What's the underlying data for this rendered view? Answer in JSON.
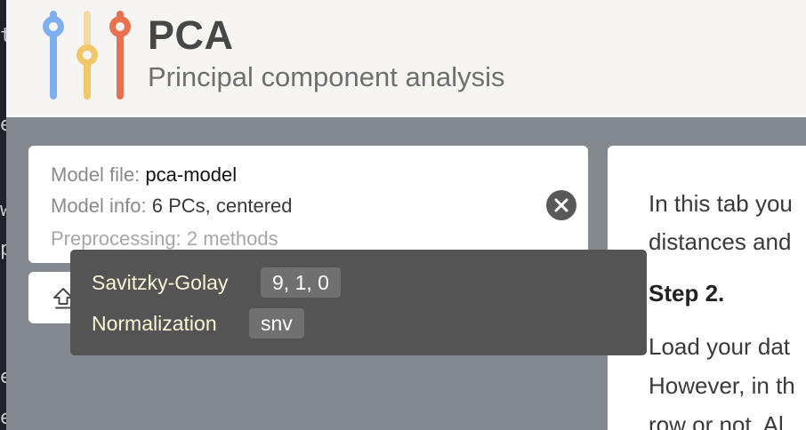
{
  "app": {
    "title": "PCA",
    "subtitle": "Principal component analysis"
  },
  "colors": {
    "background": "#84898f",
    "header": "#f6f5f4",
    "logo_blue": "#7fb0ee",
    "logo_yellow": "#f2c76a",
    "logo_red": "#e8714f",
    "tooltip_bg": "#545454",
    "tooltip_text": "#f9f5d8"
  },
  "model_card": {
    "file_label": "Model file:",
    "file_value": "pca-model",
    "info_label": "Model info:",
    "info_value": "6 PCs, centered",
    "preproc_label": "Preprocessing:",
    "preproc_value": "2 methods",
    "clear_icon": "close-icon"
  },
  "upload_button": {
    "icon": "upload-icon"
  },
  "help": {
    "line1": "In this tab you",
    "line2": "distances and",
    "step_heading": "Step 2.",
    "line3": "Load your dat",
    "line4": "However, in th",
    "line5": "row or not. Al"
  },
  "tooltip": {
    "items": [
      {
        "name": "Savitzky-Golay",
        "value": "9, 1, 0"
      },
      {
        "name": "Normalization",
        "value": "snv"
      }
    ]
  },
  "left_strip": {
    "glyphs": [
      "t",
      "e",
      "w",
      "p",
      "e",
      "e"
    ]
  }
}
